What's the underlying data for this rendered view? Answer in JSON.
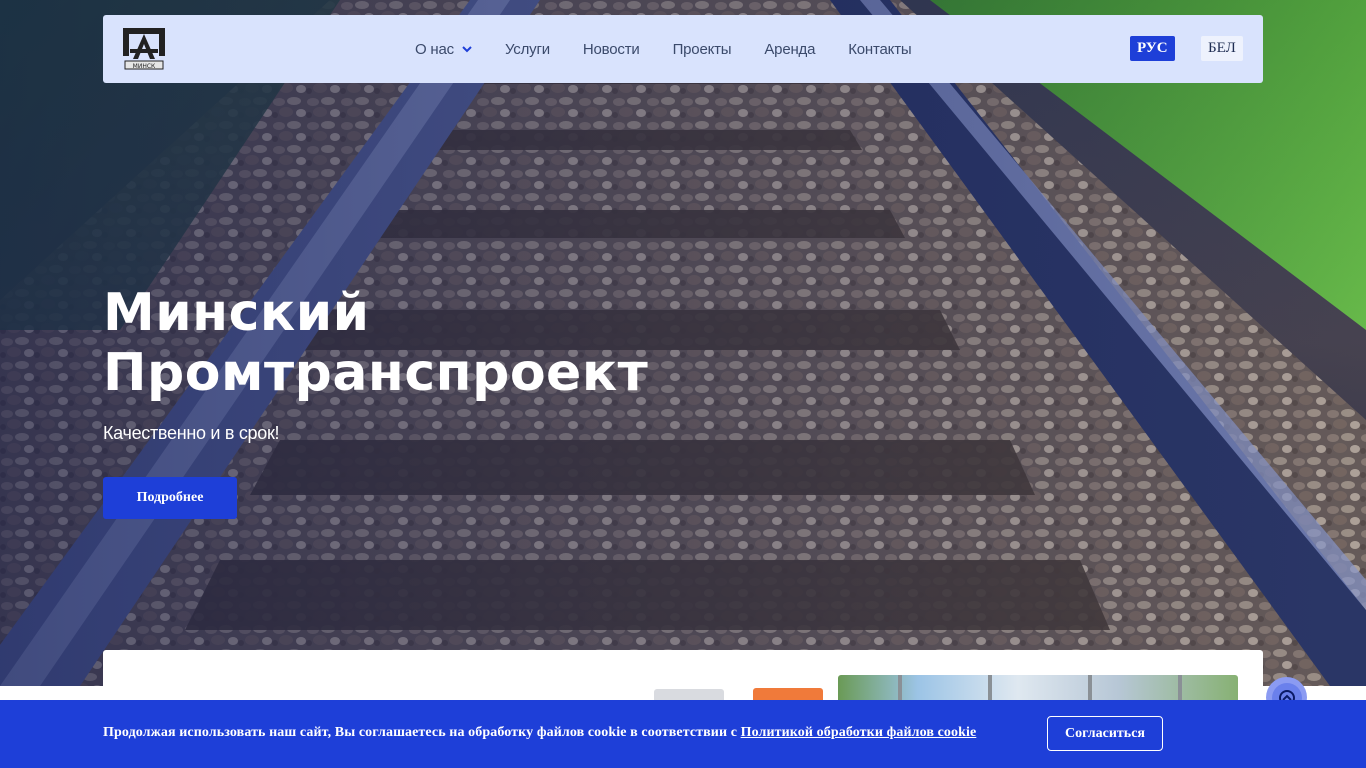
{
  "nav": {
    "logo_icon": "minsk-logo-icon",
    "logo_text": "МИНСК",
    "items": [
      {
        "label": "О нас",
        "has_dropdown": true
      },
      {
        "label": "Услуги"
      },
      {
        "label": "Новости"
      },
      {
        "label": "Проекты"
      },
      {
        "label": "Аренда"
      },
      {
        "label": "Контакты"
      }
    ],
    "lang_active": "РУС",
    "lang_other": "БЕЛ"
  },
  "hero": {
    "title_line1": "Минский",
    "title_line2": "Промтранспроект",
    "subtitle": "Качественно и в срок!",
    "button_label": "Подробнее"
  },
  "cookie": {
    "text": "Продолжая использовать наш сайт, Вы соглашаетесь на обработку файлов cookie в соответствии с ",
    "link_text": "Политикой обработки файлов cookie",
    "accept_label": "Согласиться"
  },
  "colors": {
    "accent": "#1e3fd8",
    "navbar_bg": "#d9e3fd",
    "nav_text": "#3b4a6b"
  },
  "icons": {
    "dropdown": "chevron-down-icon",
    "scroll_top": "chevron-up-icon"
  }
}
